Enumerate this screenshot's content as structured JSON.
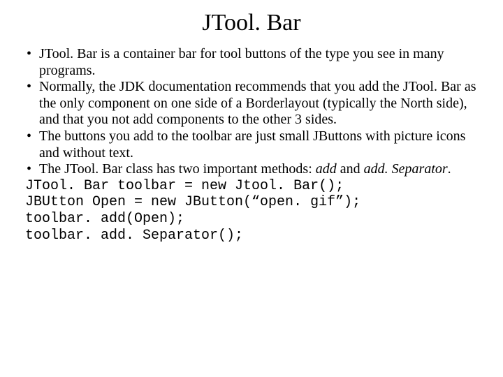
{
  "title": "JTool. Bar",
  "bullets": [
    {
      "text": "JTool. Bar is a container bar for tool buttons of the type you see in many programs."
    },
    {
      "text": "Normally, the JDK documentation recommends that you add the JTool. Bar as the only component on one side of a Borderlayout (typically the North side), and that you not add components to the other 3 sides."
    },
    {
      "text": "The buttons you add to the toolbar are just small JButtons with picture icons and without text."
    },
    {
      "pre": "The JTool. Bar class has two important methods: ",
      "em1": "add",
      "mid": " and ",
      "em2": "add. Separator",
      "post": "."
    }
  ],
  "code": "JTool. Bar toolbar = new Jtool. Bar();\nJBUtton Open = new JButton(“open. gif”);\ntoolbar. add(Open);\ntoolbar. add. Separator();"
}
